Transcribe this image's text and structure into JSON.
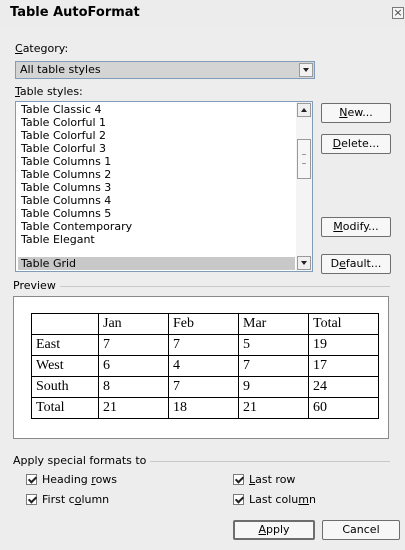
{
  "dialog": {
    "title": "Table AutoFormat",
    "close_glyph": "×"
  },
  "category": {
    "label_key": "C",
    "label_rest": "ategory:",
    "value": "All table styles"
  },
  "styles": {
    "label_key": "T",
    "label_rest": "able styles:",
    "items": [
      "Table Classic 4",
      "Table Colorful 1",
      "Table Colorful 2",
      "Table Colorful 3",
      "Table Columns 1",
      "Table Columns 2",
      "Table Columns 3",
      "Table Columns 4",
      "Table Columns 5",
      "Table Contemporary",
      "Table Elegant",
      "Table Grid"
    ],
    "selected": "Table Grid"
  },
  "buttons": {
    "new": {
      "key": "N",
      "rest": "ew..."
    },
    "delete": {
      "key": "D",
      "rest": "elete..."
    },
    "modify": {
      "key": "M",
      "rest": "odify..."
    },
    "default": {
      "pre": "D",
      "key": "e",
      "rest": "fault..."
    },
    "apply": {
      "key": "A",
      "rest": "pply"
    },
    "cancel": "Cancel"
  },
  "preview": {
    "label": "Preview",
    "header": [
      "",
      "Jan",
      "Feb",
      "Mar",
      "Total"
    ],
    "rows": [
      [
        "East",
        "7",
        "7",
        "5",
        "19"
      ],
      [
        "West",
        "6",
        "4",
        "7",
        "17"
      ],
      [
        "South",
        "8",
        "7",
        "9",
        "24"
      ],
      [
        "Total",
        "21",
        "18",
        "21",
        "60"
      ]
    ]
  },
  "special_formats": {
    "label": "Apply special formats to",
    "heading_rows": {
      "pre": "Heading ",
      "key": "r",
      "rest": "ows",
      "checked": true
    },
    "first_column": {
      "pre": "First c",
      "key": "o",
      "rest": "lumn",
      "checked": true
    },
    "last_row": {
      "pre": "",
      "key": "L",
      "rest": "ast row",
      "checked": true
    },
    "last_column": {
      "pre": "Last colu",
      "key": "m",
      "rest": "n",
      "checked": true
    }
  }
}
